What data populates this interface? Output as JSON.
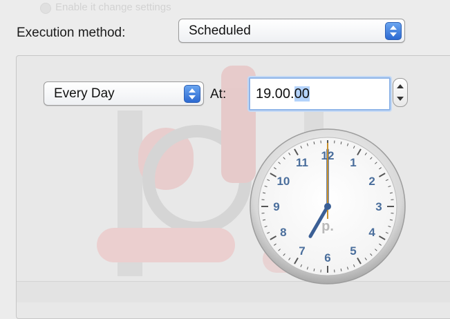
{
  "header": {
    "faded_checkbox_label": "Enable it change settings"
  },
  "execution": {
    "label": "Execution method:",
    "selected": "Scheduled"
  },
  "schedule": {
    "frequency": "Every Day",
    "at_label": "At:",
    "time_prefix": "19.00.",
    "time_selected": "00"
  },
  "clock": {
    "numbers": [
      "12",
      "1",
      "2",
      "3",
      "4",
      "5",
      "6",
      "7",
      "8",
      "9",
      "10",
      "11"
    ],
    "meridiem": "p.",
    "hour": 7,
    "minute": 0,
    "second": 0,
    "number_color": "#4a6e9c",
    "hand_color": "#3b5f95",
    "second_hand_color": "#c8902c"
  },
  "colors": {
    "accent": "#2c69d1",
    "selection": "#b4d3fb"
  }
}
